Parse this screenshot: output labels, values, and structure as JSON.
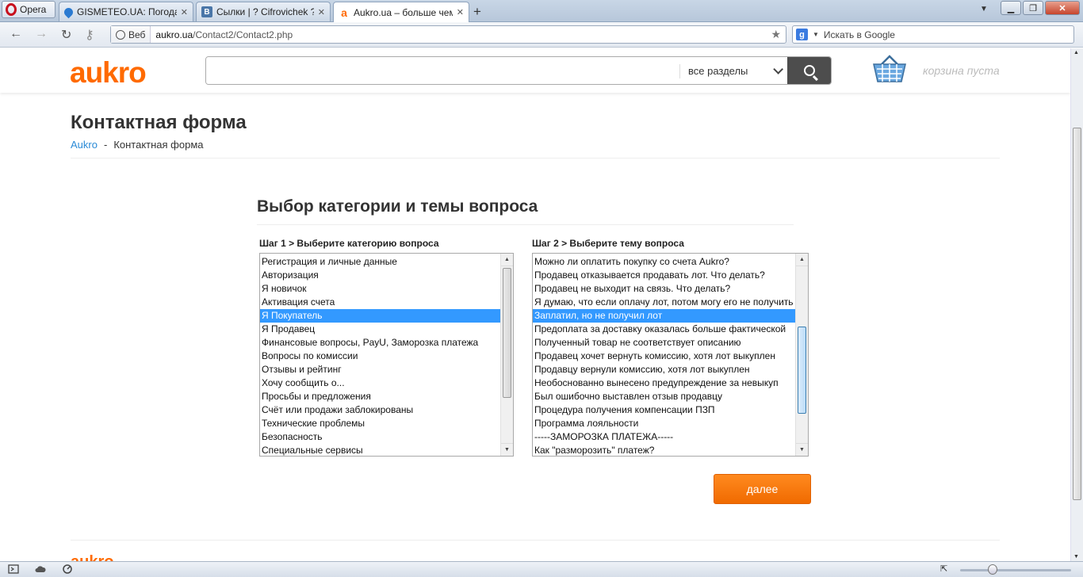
{
  "browser": {
    "menu_label": "Opera",
    "tabs": [
      {
        "title": "GISMETEO.UA: Погода...",
        "favicon": "gismeteo-drop-icon"
      },
      {
        "title": "Сылки | ? Cifrovichek ?",
        "favicon": "vk-icon"
      },
      {
        "title": "Aukro.ua – больше чем...",
        "favicon": "aukro-a-icon"
      }
    ],
    "new_tab": "+",
    "address": {
      "badge": "Веб",
      "domain": "aukro.ua",
      "path": "/Contact2/Contact2.php"
    },
    "search_placeholder": "Искать в Google"
  },
  "header": {
    "logo": "aukro",
    "search_placeholder": "",
    "section_select": "все разделы",
    "cart_text": "корзина пуста"
  },
  "page": {
    "title": "Контактная форма",
    "breadcrumb": {
      "home": "Aukro",
      "sep": "-",
      "current": "Контактная форма"
    },
    "form_heading": "Выбор категории и темы вопроса",
    "step1_label": "Шаг 1 > Выберите категорию вопроса",
    "step2_label": "Шаг 2 > Выберите тему вопроса",
    "categories": [
      "Регистрация и личные данные",
      "Авторизация",
      "Я новичок",
      "Активация счета",
      "Я Покупатель",
      "Я Продавец",
      "Финансовые вопросы, PayU, Заморозка платежа",
      "Вопросы по комиссии",
      "Отзывы и рейтинг",
      "Хочу сообщить о...",
      "Просьбы и предложения",
      "Счёт или продажи заблокированы",
      "Технические проблемы",
      "Безопасность",
      "Специальные сервисы"
    ],
    "selected_category": "Я Покупатель",
    "topics": [
      "Можно ли оплатить покупку со счета Aukro?",
      "Продавец отказывается продавать лот. Что делать?",
      "Продавец не выходит на связь. Что делать?",
      "Я думаю, что если оплачу лот, потом могу его не получить",
      "Заплатил, но не получил лот",
      "Предоплата за доставку оказалась больше фактической",
      "Полученный товар не соответствует описанию",
      "Продавец хочет вернуть комиссию, хотя лот выкуплен",
      "Продавцу вернули комиссию, хотя лот выкуплен",
      "Необоснованно вынесено предупреждение за невыкуп",
      "Был ошибочно выставлен отзыв продавцу",
      "Процедура получения компенсации ПЗП",
      "Программа лояльности",
      "-----ЗАМОРОЗКА ПЛАТЕЖА-----",
      "Как \"разморозить\" платеж?"
    ],
    "selected_topic": "Заплатил, но не получил лот",
    "next_button": "далее"
  },
  "footer": {
    "logo": "aukro"
  },
  "colors": {
    "brand": "#ff6a00",
    "selection": "#3399ff",
    "link": "#2a8ad6"
  }
}
